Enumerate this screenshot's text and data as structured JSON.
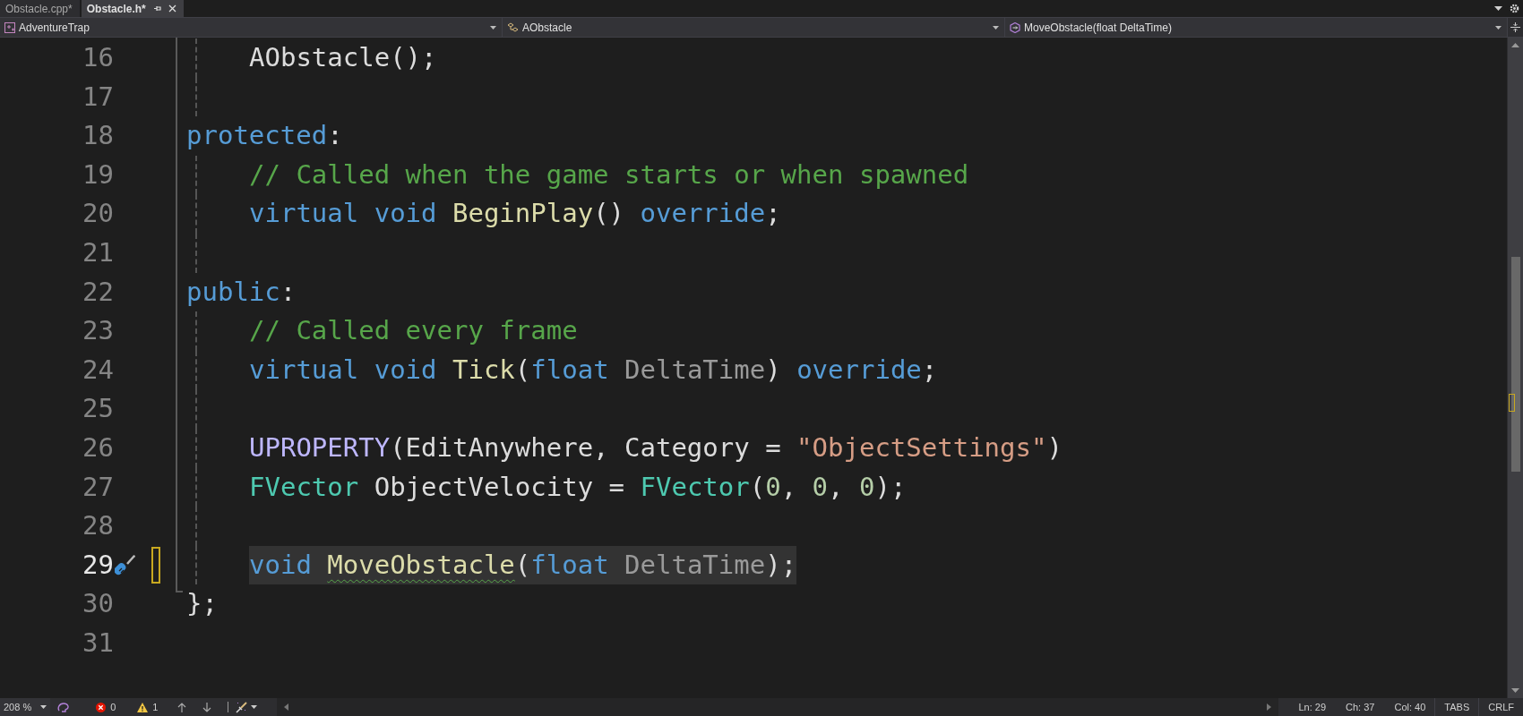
{
  "tabs": [
    {
      "label": "Obstacle.cpp*",
      "selected": false
    },
    {
      "label": "Obstacle.h*",
      "selected": true
    }
  ],
  "nav": {
    "project": "AdventureTrap",
    "class": "AObstacle",
    "member": "MoveObstacle(float DeltaTime)"
  },
  "lines": [
    {
      "number": "16",
      "current": false,
      "changed": false,
      "indented": true,
      "tokens": [
        {
          "kind": "plain",
          "text": "AObstacle();"
        }
      ]
    },
    {
      "number": "17",
      "current": false,
      "changed": false,
      "indented": true
    },
    {
      "number": "18",
      "current": false,
      "changed": false,
      "indented": false,
      "tokens": [
        {
          "kind": "keyword",
          "text": "protected"
        },
        {
          "kind": "plain",
          "text": ":"
        }
      ]
    },
    {
      "number": "19",
      "current": false,
      "changed": false,
      "indented": true,
      "tokens": [
        {
          "kind": "comment",
          "text": "// Called when the game starts or when spawned"
        }
      ]
    },
    {
      "number": "20",
      "current": false,
      "changed": false,
      "indented": true,
      "tokens": [
        {
          "kind": "keyword",
          "text": "virtual void "
        },
        {
          "kind": "function",
          "text": "BeginPlay"
        },
        {
          "kind": "plain",
          "text": "() "
        },
        {
          "kind": "keyword",
          "text": "override"
        },
        {
          "kind": "plain",
          "text": ";"
        }
      ]
    },
    {
      "number": "21",
      "current": false,
      "changed": false,
      "indented": true
    },
    {
      "number": "22",
      "current": false,
      "changed": false,
      "indented": false,
      "tokens": [
        {
          "kind": "keyword",
          "text": "public"
        },
        {
          "kind": "plain",
          "text": ":"
        }
      ]
    },
    {
      "number": "23",
      "current": false,
      "changed": false,
      "indented": true,
      "tokens": [
        {
          "kind": "comment",
          "text": "// Called every frame"
        }
      ]
    },
    {
      "number": "24",
      "current": false,
      "changed": false,
      "indented": true,
      "tokens": [
        {
          "kind": "keyword",
          "text": "virtual void "
        },
        {
          "kind": "function",
          "text": "Tick"
        },
        {
          "kind": "plain",
          "text": "("
        },
        {
          "kind": "keyword",
          "text": "float "
        },
        {
          "kind": "param",
          "text": "DeltaTime"
        },
        {
          "kind": "plain",
          "text": ") "
        },
        {
          "kind": "keyword",
          "text": "override"
        },
        {
          "kind": "plain",
          "text": ";"
        }
      ]
    },
    {
      "number": "25",
      "current": false,
      "changed": false,
      "indented": true
    },
    {
      "number": "26",
      "current": false,
      "changed": false,
      "indented": true,
      "tokens": [
        {
          "kind": "macro",
          "text": "UPROPERTY"
        },
        {
          "kind": "plain",
          "text": "(EditAnywhere, Category = "
        },
        {
          "kind": "string",
          "text": "\"ObjectSettings\""
        },
        {
          "kind": "plain",
          "text": ")"
        }
      ]
    },
    {
      "number": "27",
      "current": false,
      "changed": false,
      "indented": true,
      "tokens": [
        {
          "kind": "type",
          "text": "FVector "
        },
        {
          "kind": "plain",
          "text": "ObjectVelocity = "
        },
        {
          "kind": "type",
          "text": "FVector"
        },
        {
          "kind": "plain",
          "text": "("
        },
        {
          "kind": "number",
          "text": "0"
        },
        {
          "kind": "plain",
          "text": ", "
        },
        {
          "kind": "number",
          "text": "0"
        },
        {
          "kind": "plain",
          "text": ", "
        },
        {
          "kind": "number",
          "text": "0"
        },
        {
          "kind": "plain",
          "text": ");"
        }
      ]
    },
    {
      "number": "28",
      "current": false,
      "changed": false,
      "indented": true
    },
    {
      "number": "29",
      "current": true,
      "changed": true,
      "indented": true,
      "tokens": [
        {
          "kind": "keyword",
          "text": "void "
        },
        {
          "kind": "function_warning",
          "text": "MoveObstacle"
        },
        {
          "kind": "plain",
          "text": "("
        },
        {
          "kind": "keyword",
          "text": "float "
        },
        {
          "kind": "param",
          "text": "DeltaTime"
        },
        {
          "kind": "plain",
          "text": ");"
        }
      ]
    },
    {
      "number": "30",
      "current": false,
      "changed": false,
      "indented": false,
      "tokens": [
        {
          "kind": "plain",
          "text": "};"
        }
      ]
    },
    {
      "number": "31",
      "current": false,
      "changed": false,
      "indented": false
    }
  ],
  "status_bar": {
    "zoom": "208 %",
    "errors": "0",
    "warnings": "1",
    "line": "Ln: 29",
    "char": "Ch: 37",
    "column": "Col: 40",
    "indent_mode": "TABS",
    "line_ending": "CRLF"
  }
}
